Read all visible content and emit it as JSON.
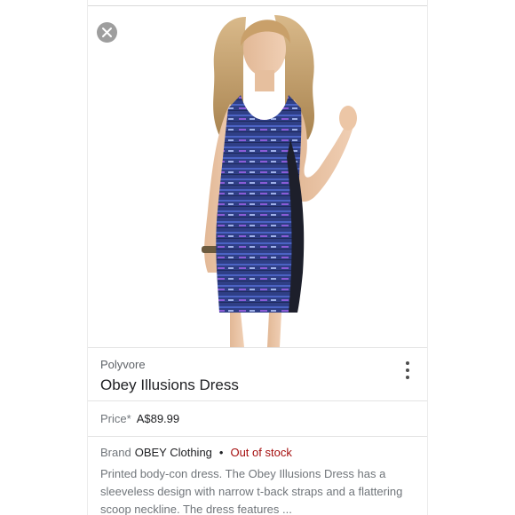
{
  "product_card": {
    "source": "Polyvore",
    "title": "Obey Illusions Dress",
    "price_label": "Price*",
    "price_value": "A$89.99",
    "brand_label": "Brand",
    "brand_name": "OBEY Clothing",
    "separator": "•",
    "stock_status": "Out of stock",
    "description": "Printed body-con dress. The Obey Illusions Dress has a sleeveless design with narrow t-back straps and a flattering scoop neckline. The dress features ..."
  },
  "icons": {
    "close": "close-icon",
    "more": "more-vert-icon"
  },
  "colors": {
    "stock_status": "#a50e0e",
    "dress_primary": "#3b4fa8",
    "dress_accent": "#8a5cd6"
  }
}
